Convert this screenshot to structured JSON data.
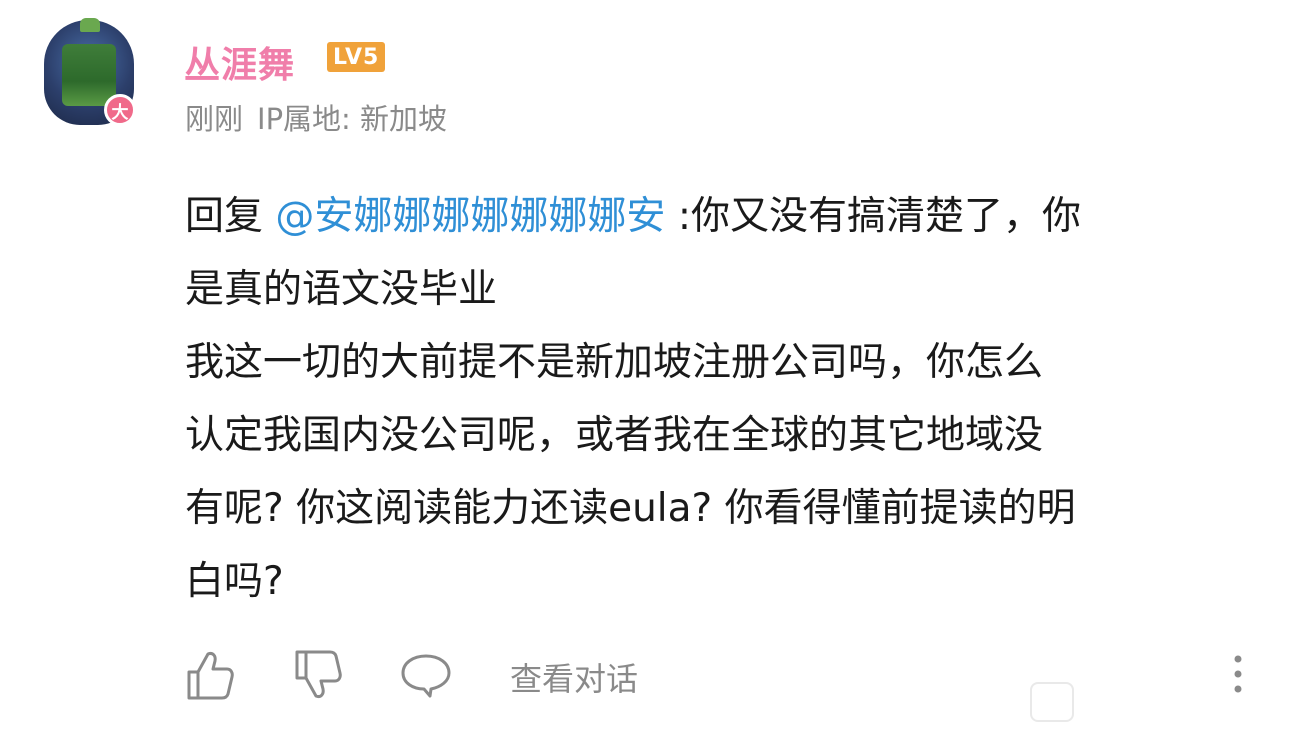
{
  "user": {
    "name": "丛涯舞",
    "level": "LV5",
    "badge": "大",
    "time": "刚刚",
    "ip_location": "IP属地: 新加坡"
  },
  "comment": {
    "reply_prefix": "回复 ",
    "mention": "@安娜娜娜娜娜娜娜安",
    "line1_rest": " :你又没有搞清楚了，你",
    "line2": "是真的语文没毕业",
    "line3": "我这一切的大前提不是新加坡注册公司吗，你怎么",
    "line4": "认定我国内没公司呢，或者我在全球的其它地域没",
    "line5": "有呢? 你这阅读能力还读eula? 你看得懂前提读的明",
    "line6": "白吗?"
  },
  "actions": {
    "view_dialog": "查看对话"
  },
  "colors": {
    "username": "#f07eaa",
    "level_badge": "#f0a23a",
    "mention": "#2f8fd6",
    "meta": "#8a8a8a"
  },
  "icons": [
    "thumbs-up-icon",
    "thumbs-down-icon",
    "comment-bubble-icon",
    "more-vertical-icon"
  ]
}
